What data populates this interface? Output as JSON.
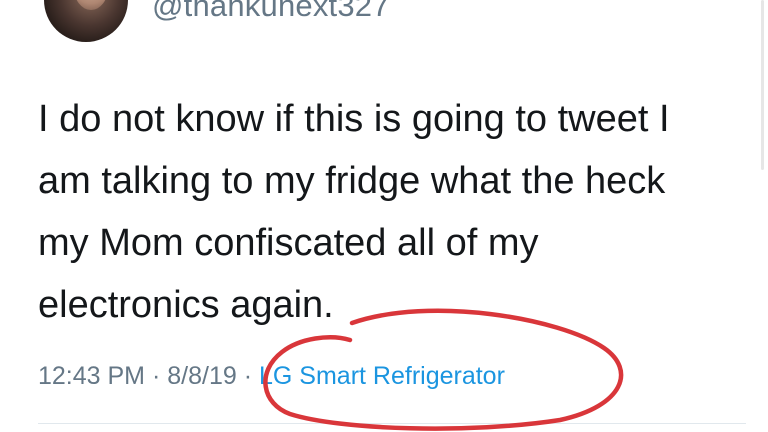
{
  "user": {
    "handle": "@thankunext327"
  },
  "tweet": {
    "text": "I do not know if this is going to tweet I\nam talking to my fridge what the heck\nmy Mom confiscated all of my\nelectronics again.",
    "time": "12:43 PM",
    "separator": "·",
    "date": "8/8/19",
    "source": "LG Smart Refrigerator"
  },
  "colors": {
    "text": "#14171a",
    "meta_gray": "#657786",
    "link_blue": "#1b95e0",
    "annotation_red": "#d9363a"
  },
  "icons": {
    "avatar": "profile-photo"
  }
}
